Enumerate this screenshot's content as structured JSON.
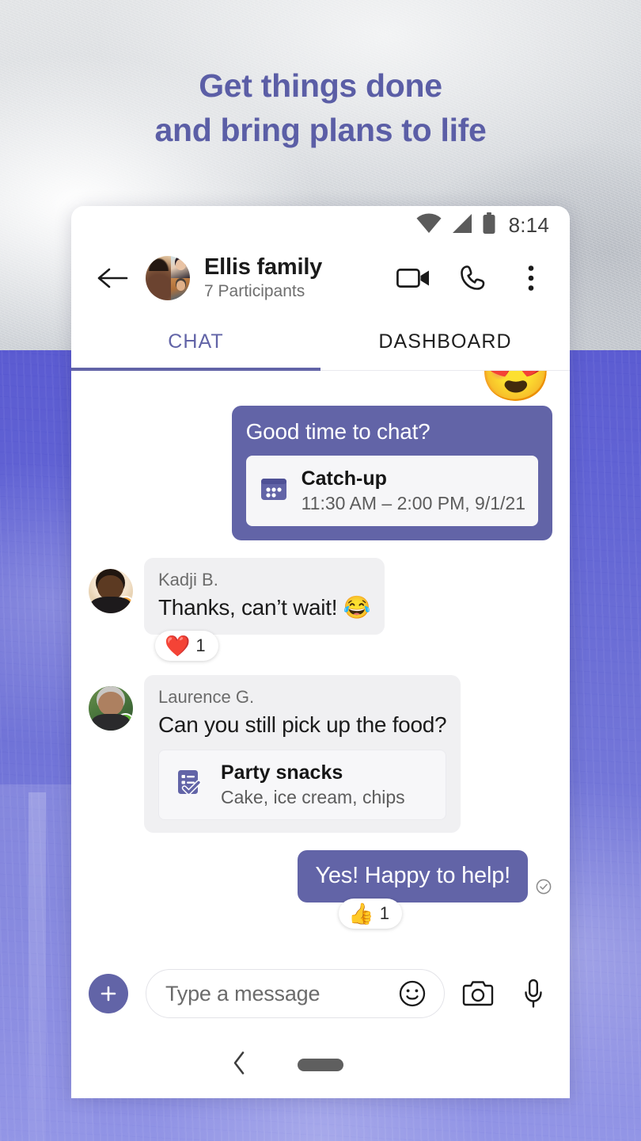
{
  "promo": {
    "headline_line1": "Get things done",
    "headline_line2": "and bring plans to life",
    "headline_color": "#5b5ea6"
  },
  "theme": {
    "accent": "#6264a7",
    "bubble_in_bg": "#f0f0f2",
    "away_color": "#f2a33c",
    "available_color": "#5cb335"
  },
  "status_bar": {
    "wifi_icon": "wifi-icon",
    "signal_icon": "cellular-signal-icon",
    "battery_icon": "battery-icon",
    "time": "8:14"
  },
  "chat_header": {
    "back_icon": "back-arrow-icon",
    "avatar_icon": "group-avatar",
    "title": "Ellis family",
    "subtitle": "7 Participants",
    "video_icon": "video-camera-icon",
    "call_icon": "phone-icon",
    "more_icon": "more-vertical-icon"
  },
  "tabs": [
    {
      "label": "CHAT",
      "active": true
    },
    {
      "label": "DASHBOARD",
      "active": false
    }
  ],
  "messages": [
    {
      "id": "emoji-clip",
      "type": "emoji",
      "emoji": "😍"
    },
    {
      "id": "meeting",
      "direction": "out",
      "text": "Good time to chat?",
      "card": {
        "icon": "calendar-icon",
        "title": "Catch-up",
        "subtitle": "11:30 AM – 2:00 PM, 9/1/21"
      }
    },
    {
      "id": "kadji",
      "direction": "in",
      "sender": "Kadji B.",
      "presence": "away",
      "text": "Thanks, can’t wait! 😂",
      "reaction": {
        "emoji": "❤️",
        "count": "1"
      }
    },
    {
      "id": "laurence",
      "direction": "in",
      "sender": "Laurence G.",
      "presence": "available",
      "text": "Can you still pick up the food?",
      "card": {
        "icon": "task-list-icon",
        "title": "Party snacks",
        "subtitle": "Cake, ice cream, chips"
      }
    },
    {
      "id": "reply",
      "direction": "out",
      "text": "Yes! Happy to help!",
      "status_icon": "delivered-check-icon",
      "reaction": {
        "emoji": "👍",
        "count": "1"
      }
    }
  ],
  "compose": {
    "add_icon": "plus-icon",
    "add_label": "+",
    "placeholder": "Type a message",
    "value": "",
    "emoji_icon": "emoji-smiley-icon",
    "camera_icon": "camera-icon",
    "mic_icon": "microphone-icon"
  },
  "nav_bar": {
    "back_icon": "nav-back-icon",
    "home_icon": "nav-home-pill"
  }
}
